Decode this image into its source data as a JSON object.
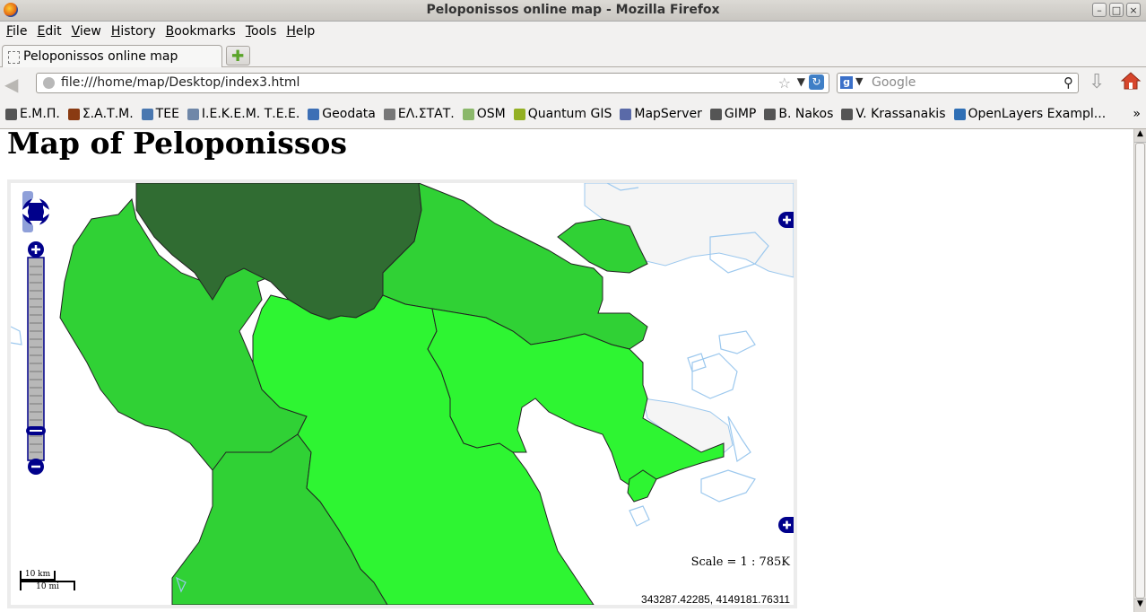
{
  "window": {
    "title": "Peloponissos online map - Mozilla Firefox"
  },
  "menu": [
    {
      "label": "File",
      "key": "F",
      "rest": "ile"
    },
    {
      "label": "Edit",
      "key": "E",
      "rest": "dit"
    },
    {
      "label": "View",
      "key": "V",
      "rest": "iew"
    },
    {
      "label": "History",
      "key": "H",
      "rest": "istory"
    },
    {
      "label": "Bookmarks",
      "key": "B",
      "rest": "ookmarks"
    },
    {
      "label": "Tools",
      "key": "T",
      "rest": "ools"
    },
    {
      "label": "Help",
      "key": "H",
      "rest": "elp"
    }
  ],
  "tabs": [
    {
      "label": "Peloponissos online map",
      "active": true
    }
  ],
  "nav": {
    "url": "file:///home/map/Desktop/index3.html",
    "search_engine": "Google",
    "search_placeholder": "Google"
  },
  "bookmarks": [
    {
      "label": "Ε.Μ.Π.",
      "icon": "emp-icon",
      "color": "#555555"
    },
    {
      "label": "Σ.Α.Τ.Μ.",
      "icon": "satm-icon",
      "color": "#8a3b12"
    },
    {
      "label": "TEE",
      "icon": "tee-icon",
      "color": "#4a78b0"
    },
    {
      "label": "Ι.Ε.Κ.Ε.Μ. Τ.Ε.Ε.",
      "icon": "iekem-icon",
      "color": "#6f87a8"
    },
    {
      "label": "Geodata",
      "icon": "book-icon",
      "color": "#3d6fb5"
    },
    {
      "label": "ΕΛ.ΣΤΑΤ.",
      "icon": "star-burst-icon",
      "color": "#777777"
    },
    {
      "label": "OSM",
      "icon": "osm-icon",
      "color": "#8bb86b"
    },
    {
      "label": "Quantum GIS",
      "icon": "qgis-icon",
      "color": "#93b023"
    },
    {
      "label": "MapServer",
      "icon": "mapserver-icon",
      "color": "#5a6aa8"
    },
    {
      "label": "GIMP",
      "icon": "gimp-icon",
      "color": "#555555"
    },
    {
      "label": "B. Nakos",
      "icon": "nakos-icon",
      "color": "#555555"
    },
    {
      "label": "V. Krassanakis",
      "icon": "krassanakis-icon",
      "color": "#555555"
    },
    {
      "label": "OpenLayers Exampl...",
      "icon": "openlayers-icon",
      "color": "#2f6fb5"
    }
  ],
  "bookmarks_more": "»",
  "page": {
    "heading": "Map of Peloponissos"
  },
  "map": {
    "scale_text": "Scale = 1 : 785K",
    "coordinates": "343287.42285, 4149181.76311",
    "scale_km": "10 km",
    "scale_mi": "10 mi",
    "colors": {
      "sea": "#ffffff",
      "coast": "#9cc8ee",
      "light_region": "#2ef532",
      "mid_region": "#30d135",
      "dark_region": "#306c32",
      "gray_land": "#f5f5f5",
      "control_blue": "#00008b"
    },
    "zoom_level_fraction": 0.12
  }
}
